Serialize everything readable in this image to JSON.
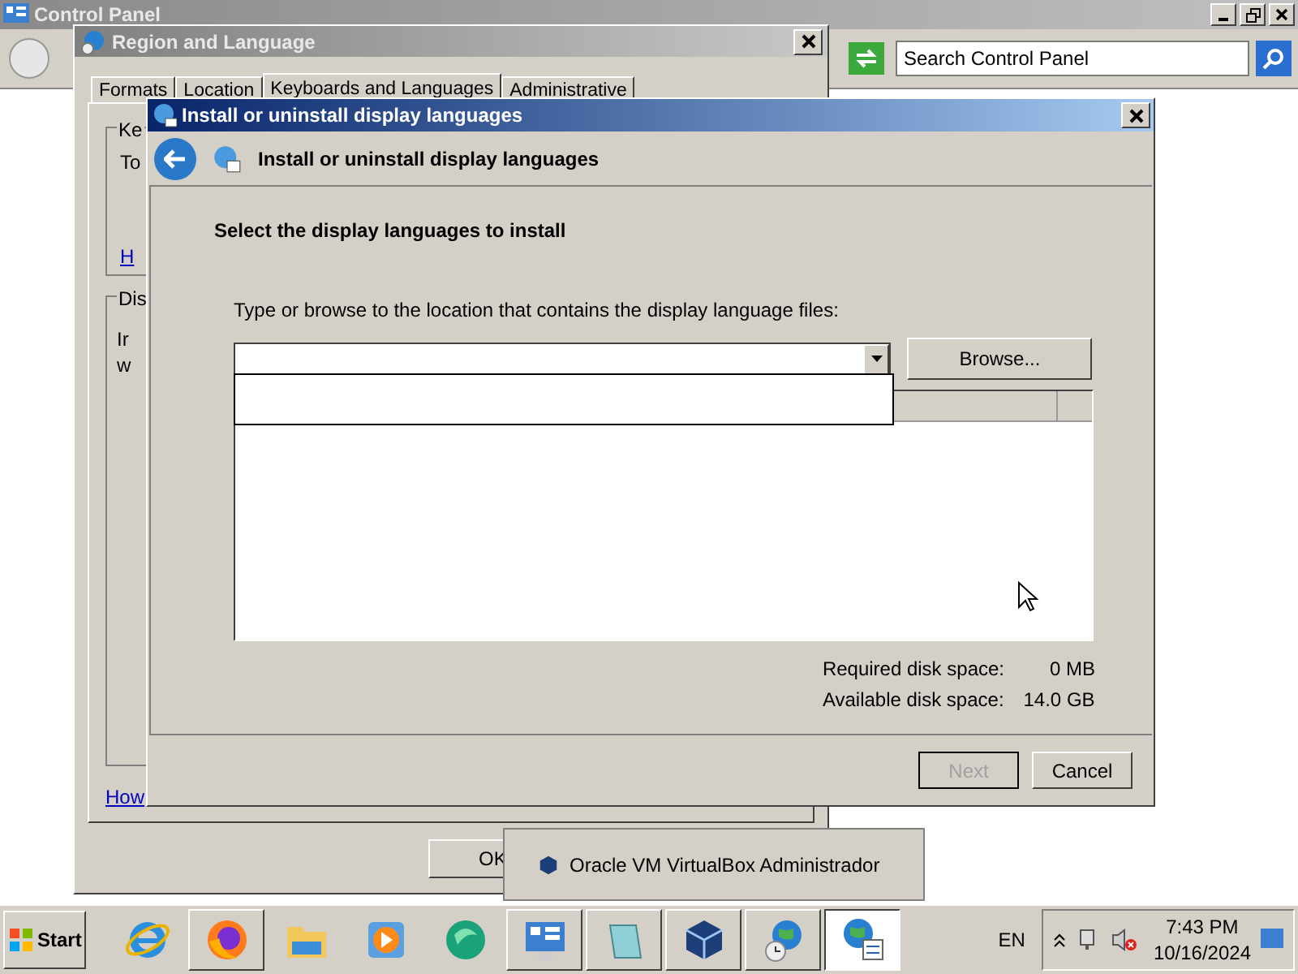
{
  "control_panel": {
    "title": "Control Panel",
    "search": {
      "placeholder": "Search Control Panel"
    }
  },
  "region_window": {
    "title": "Region and Language",
    "tabs": [
      {
        "label": "Formats",
        "selected": false
      },
      {
        "label": "Location",
        "selected": false
      },
      {
        "label": "Keyboards and Languages",
        "selected": true
      },
      {
        "label": "Administrative",
        "selected": false
      }
    ],
    "keyboards_group": {
      "label": "Ke",
      "text": "To",
      "link": "H"
    },
    "display_group": {
      "label": "Dis",
      "lines": [
        "Ir",
        "w"
      ]
    },
    "help_link": "How",
    "ok_button": "OK"
  },
  "dialog": {
    "title": "Install or uninstall display languages",
    "heading": "Install or uninstall display languages",
    "instruction": "Select the display languages to install",
    "location_label": "Type or browse to the location that contains the display language files:",
    "location_dropdown": {
      "expanded": true
    },
    "browse_button": "Browse...",
    "disk": [
      {
        "label": "Required disk space:",
        "value": "0 MB"
      },
      {
        "label": "Available disk space:",
        "value": "14.0 GB"
      }
    ],
    "buttons": [
      {
        "label": "Next",
        "disabled": true
      },
      {
        "label": "Cancel",
        "disabled": false
      }
    ]
  },
  "tooltip": {
    "text": "Oracle VM VirtualBox Administrador"
  },
  "taskbar": {
    "start": "Start",
    "apps": [
      {
        "kind": "browser-e",
        "running": false,
        "selected": false
      },
      {
        "kind": "fox",
        "running": true,
        "selected": false
      },
      {
        "kind": "folder",
        "running": false,
        "selected": false
      },
      {
        "kind": "media",
        "running": false,
        "selected": false
      },
      {
        "kind": "green",
        "running": false,
        "selected": false
      },
      {
        "kind": "panel",
        "running": true,
        "selected": false
      },
      {
        "kind": "notepad",
        "running": true,
        "selected": false
      },
      {
        "kind": "cube",
        "running": true,
        "selected": false
      },
      {
        "kind": "globe-clock",
        "running": true,
        "selected": false
      },
      {
        "kind": "globe-list",
        "selected": true
      }
    ],
    "language": "EN",
    "time": "7:43 PM",
    "date": "10/16/2024"
  }
}
